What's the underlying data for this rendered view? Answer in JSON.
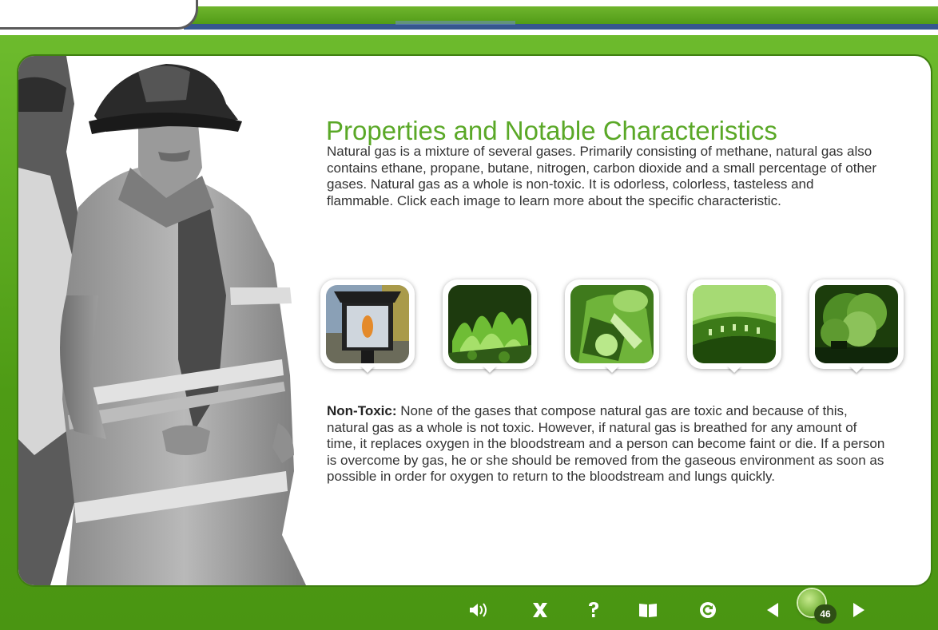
{
  "lesson": {
    "title": "Properties and Notable Characteristics",
    "intro": "Natural gas is a mixture of several gases. Primarily consisting of methane, natural gas also contains ethane, propane, butane, nitrogen, carbon dioxide and a small percentage of other gases. Natural gas as a whole is non-toxic. It is odorless, colorless, tasteless and flammable. Click each image to learn more about the specific characteristic.",
    "detail_label": "Non-Toxic:",
    "detail_text": " None of the gases that compose natural gas are toxic and because of this, natural gas as a whole is not toxic. However, if natural gas is breathed for any amount of time, it replaces oxygen in the bloodstream and a person can become faint or die. If a person is overcome by gas, he or she should be removed from the gaseous environment as soon as possible in order for oxygen to return to the bloodstream and lungs quickly."
  },
  "thumbnails": [
    {
      "icon": "gas-lantern-image",
      "active": true
    },
    {
      "icon": "gas-flames-image",
      "active": false
    },
    {
      "icon": "worker-mask-image",
      "active": false
    },
    {
      "icon": "gas-burner-image",
      "active": false
    },
    {
      "icon": "explosion-image",
      "active": false
    }
  ],
  "nav": {
    "audio_icon": "audio-icon",
    "close_icon": "close-icon",
    "help_icon": "help-icon",
    "glossary_icon": "book-icon",
    "replay_icon": "replay-icon",
    "prev_icon": "previous-icon",
    "next_icon": "next-icon",
    "page_number": "46"
  },
  "colors": {
    "frame_green": "#4f9a16",
    "title_green": "#5aa827",
    "top_blue": "#36578f"
  }
}
